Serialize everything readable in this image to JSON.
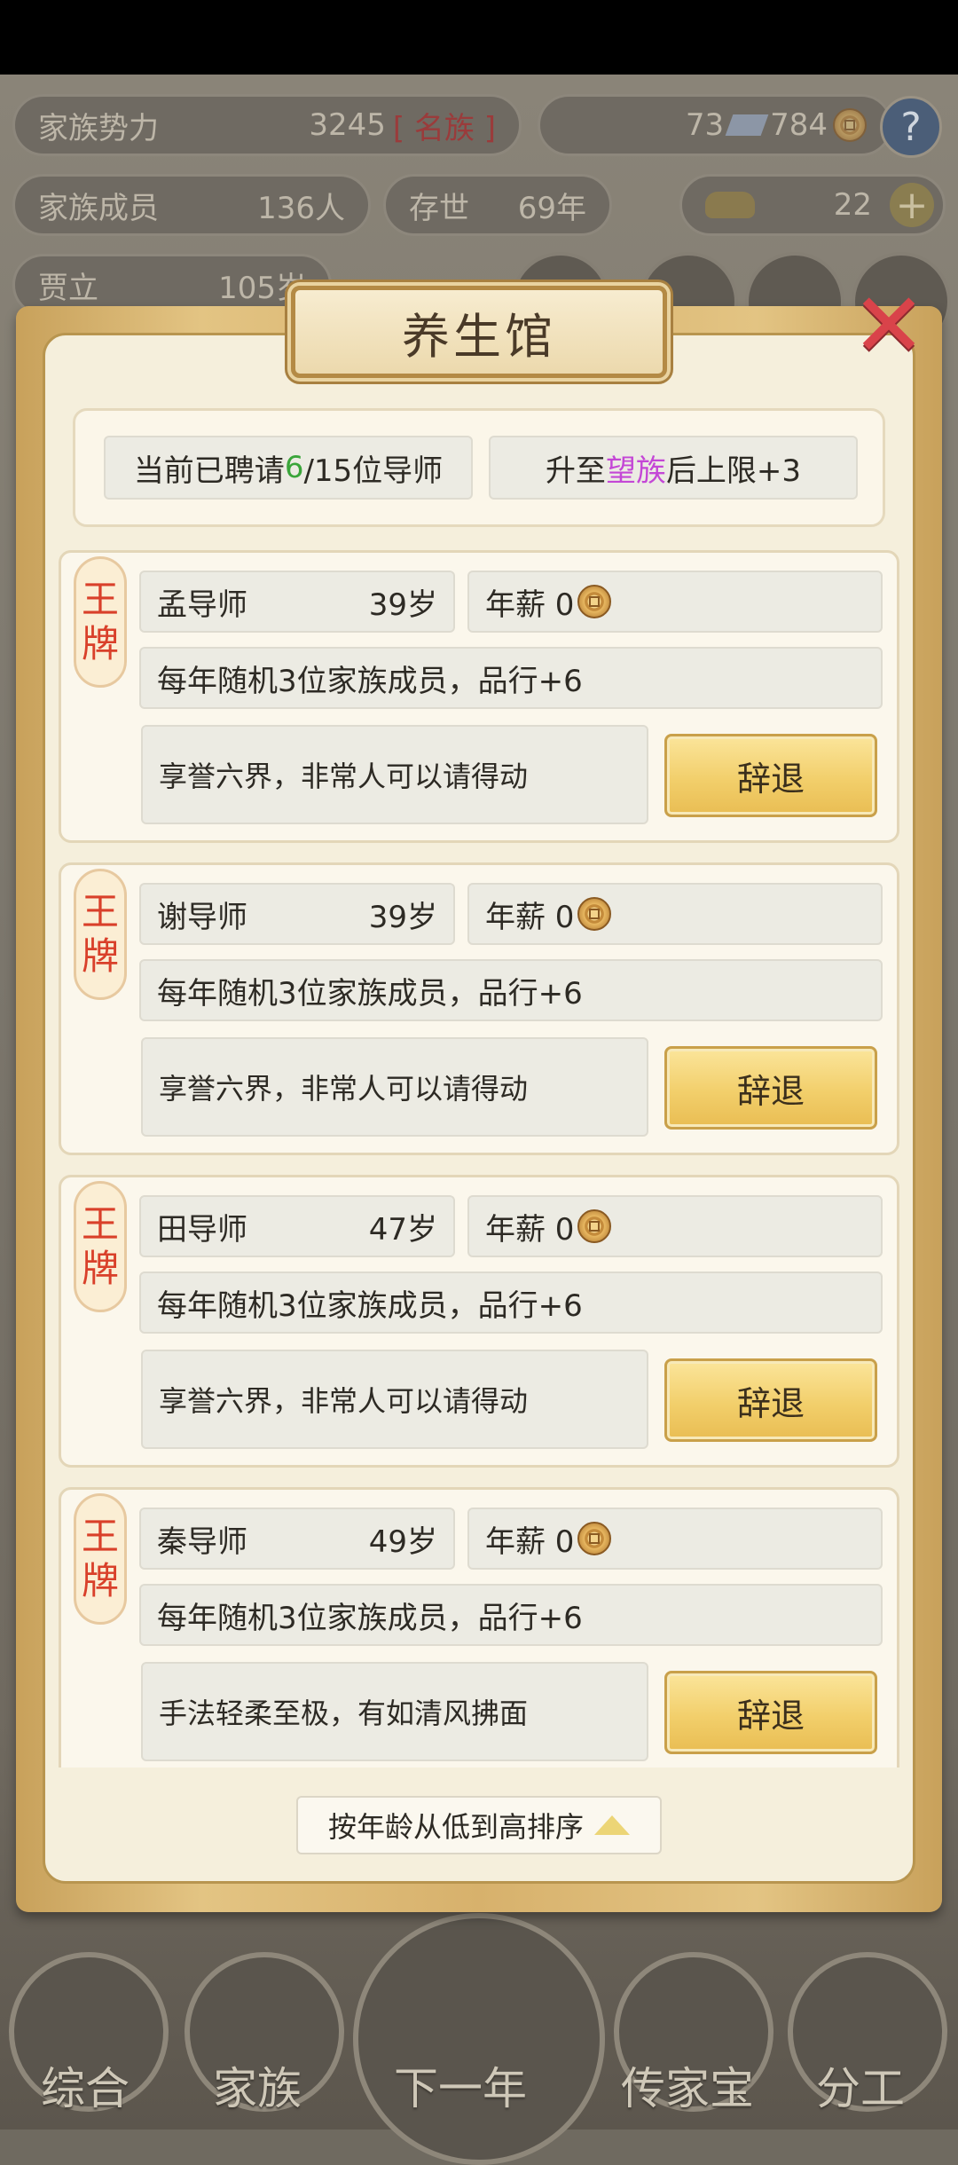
{
  "background": {
    "family_power_label": "家族势力",
    "family_power_value": "3245",
    "family_power_rank": "[ 名族 ]",
    "currency_a": "73",
    "currency_b": "784",
    "help": "?",
    "members_label": "家族成员",
    "members_value": "136人",
    "exist_label": "存世",
    "exist_value": "69年",
    "gold_value": "22",
    "person_name": "贾立",
    "person_age": "105岁",
    "nav": [
      "综合",
      "家族",
      "下一年",
      "传家宝",
      "分工"
    ]
  },
  "modal": {
    "title": "养生馆",
    "hired_prefix": "当前已聘请",
    "hired_count": "6",
    "hired_suffix": "/15位导师",
    "upgrade_prefix": "升至",
    "upgrade_rank": "望族",
    "upgrade_suffix": "后上限+3",
    "sort_label": "按年龄从低到高排序"
  },
  "mentors": [
    {
      "tag_1": "王",
      "tag_2": "牌",
      "name": "孟导师",
      "age": "39岁",
      "salary_label": "年薪 0",
      "effect": "每年随机3位家族成员，品行+6",
      "quote": "享誉六界，非常人可以请得动",
      "button": "辞退"
    },
    {
      "tag_1": "王",
      "tag_2": "牌",
      "name": "谢导师",
      "age": "39岁",
      "salary_label": "年薪 0",
      "effect": "每年随机3位家族成员，品行+6",
      "quote": "享誉六界，非常人可以请得动",
      "button": "辞退"
    },
    {
      "tag_1": "王",
      "tag_2": "牌",
      "name": "田导师",
      "age": "47岁",
      "salary_label": "年薪 0",
      "effect": "每年随机3位家族成员，品行+6",
      "quote": "享誉六界，非常人可以请得动",
      "button": "辞退"
    },
    {
      "tag_1": "王",
      "tag_2": "牌",
      "name": "秦导师",
      "age": "49岁",
      "salary_label": "年薪 0",
      "effect": "每年随机3位家族成员，品行+6",
      "quote": "手法轻柔至极，有如清风拂面",
      "button": "辞退"
    }
  ],
  "colors": {
    "accent_green": "#3aa53a",
    "accent_purple": "#c447d6",
    "tag_red": "#d9402a",
    "button_gold": "#f2cf6b"
  }
}
